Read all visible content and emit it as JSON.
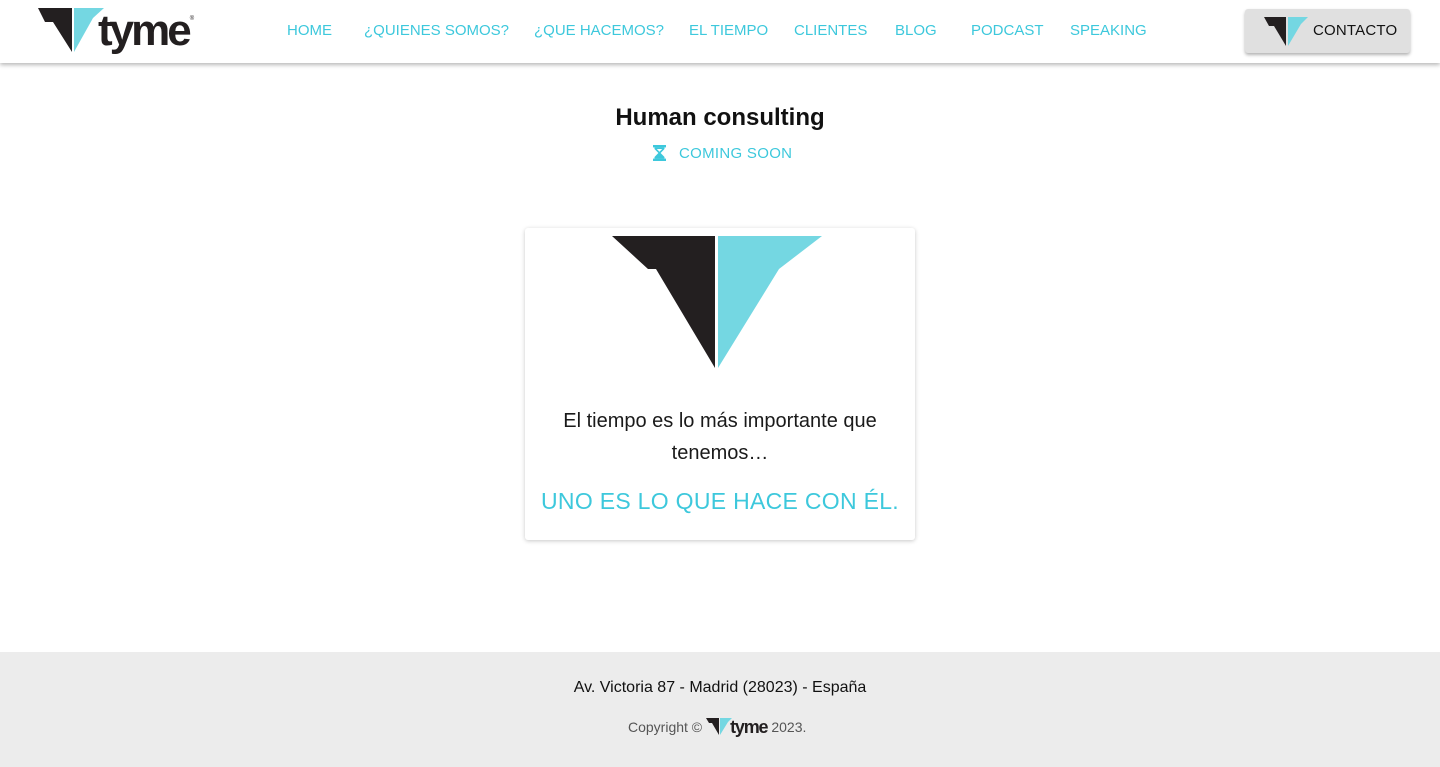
{
  "brand": {
    "name": "tyme",
    "reg_mark": "®",
    "colors": {
      "dark": "#231f20",
      "accent": "#74d7e2"
    }
  },
  "nav": {
    "items": [
      {
        "label": "HOME"
      },
      {
        "label": "¿QUIENES SOMOS?"
      },
      {
        "label": "¿QUE HACEMOS?"
      },
      {
        "label": "EL TIEMPO"
      },
      {
        "label": "CLIENTES"
      },
      {
        "label": "BLOG"
      },
      {
        "label": "PODCAST"
      },
      {
        "label": "SPEAKING"
      }
    ],
    "link_color": "#3dc8dc",
    "contact_label": "CONTACTO"
  },
  "main": {
    "title": "Human consulting",
    "status": "COMING SOON",
    "status_icon": "hourglass-icon",
    "card": {
      "quote": "El tiempo es lo más importante que tenemos…",
      "tagline": "UNO ES LO QUE HACE CON ÉL."
    }
  },
  "footer": {
    "address": "Av. Victoria 87 - Madrid (28023) - España",
    "copyright_prefix": "Copyright ©",
    "copyright_brand": "tyme",
    "copyright_year": "2023."
  }
}
